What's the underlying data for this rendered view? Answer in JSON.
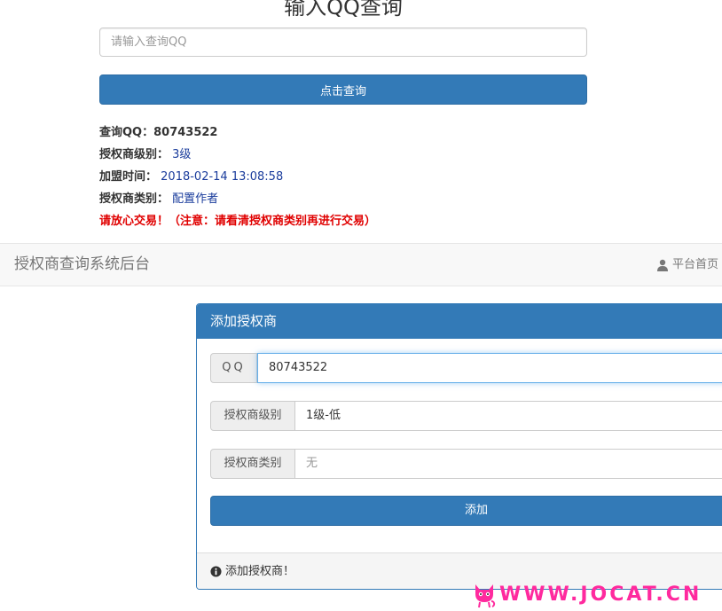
{
  "query": {
    "title": "输入QQ查询",
    "input_placeholder": "请输入查询QQ",
    "button_label": "点击查询"
  },
  "result": {
    "qq_label": "查询QQ：",
    "qq_value": "80743522",
    "level_label": "授权商级别：",
    "level_value": "3级",
    "join_label": "加盟时间：",
    "join_value": "2018-02-14 13:08:58",
    "type_label": "授权商类别：",
    "type_value": "配置作者",
    "warning": "请放心交易！（注意：请看清授权商类别再进行交易）"
  },
  "navbar": {
    "brand": "授权商查询系统后台",
    "home_link": "平台首页",
    "home_icon": "user-icon"
  },
  "panel": {
    "heading": "添加授权商",
    "qq_addon": "QQ",
    "qq_value": "80743522",
    "level_addon": "授权商级别",
    "level_value": "1级-低",
    "type_addon": "授权商类别",
    "type_value": "无",
    "add_button": "添加",
    "footer_text": "添加授权商！",
    "footer_icon": "info-circle-icon"
  },
  "watermark": {
    "text": "WWW.JOCAT.CN",
    "logo": "cat-logo"
  },
  "colors": {
    "primary": "#337ab7",
    "warning": "#e00000",
    "link_value": "#1a3c9c",
    "watermark": "#ff2a9e"
  }
}
